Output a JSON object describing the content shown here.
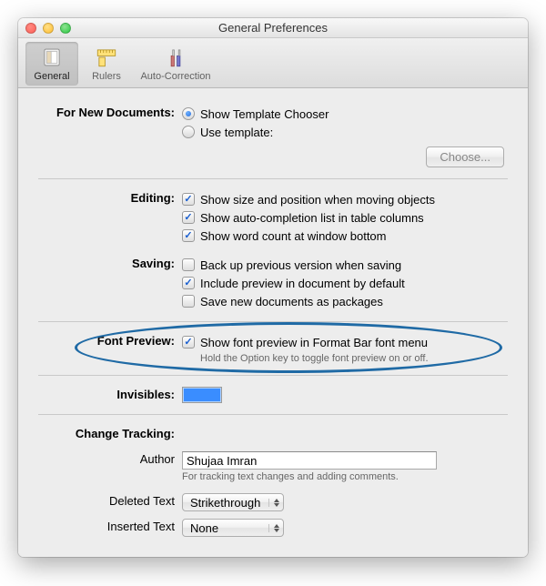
{
  "window": {
    "title": "General Preferences"
  },
  "toolbar": {
    "items": [
      {
        "label": "General"
      },
      {
        "label": "Rulers"
      },
      {
        "label": "Auto-Correction"
      }
    ]
  },
  "newDocs": {
    "label": "For New Documents:",
    "opt1": "Show Template Chooser",
    "opt2": "Use template:",
    "chooseBtn": "Choose..."
  },
  "editing": {
    "label": "Editing:",
    "c1": "Show size and position when moving objects",
    "c2": "Show auto-completion list in table columns",
    "c3": "Show word count at window bottom"
  },
  "saving": {
    "label": "Saving:",
    "c1": "Back up previous version when saving",
    "c2": "Include preview in document by default",
    "c3": "Save new documents as packages"
  },
  "fontPreview": {
    "label": "Font Preview:",
    "c1": "Show font preview in Format Bar font menu",
    "hint": "Hold the Option key to toggle font preview on or off."
  },
  "invisibles": {
    "label": "Invisibles:",
    "color": "#3a8dff"
  },
  "changeTracking": {
    "heading": "Change Tracking:",
    "authorLabel": "Author",
    "authorValue": "Shujaa Imran",
    "authorHint": "For tracking text changes and adding comments.",
    "deletedLabel": "Deleted Text",
    "deletedValue": "Strikethrough",
    "insertedLabel": "Inserted Text",
    "insertedValue": "None"
  }
}
